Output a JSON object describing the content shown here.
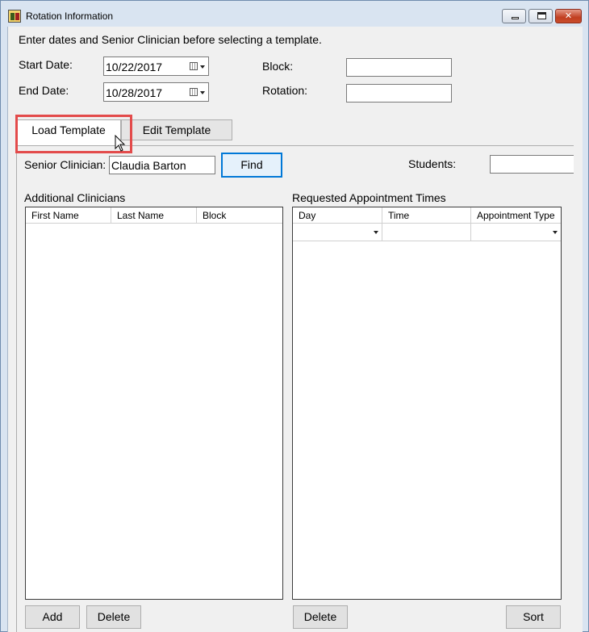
{
  "window": {
    "title": "Rotation Information",
    "controls": {
      "minimize": "minimize",
      "maximize": "maximize",
      "close": "close"
    }
  },
  "form": {
    "instructions": "Enter dates and Senior Clinician before selecting a template.",
    "start_date_label": "Start Date:",
    "start_date_value": "10/22/2017",
    "end_date_label": "End Date:",
    "end_date_value": "10/28/2017",
    "block_label": "Block:",
    "block_value": "",
    "rotation_label": "Rotation:",
    "rotation_value": ""
  },
  "tabs": [
    {
      "label": "Load Template",
      "active": true
    },
    {
      "label": "Edit Template",
      "active": false
    }
  ],
  "load_template": {
    "senior_clinician_label": "Senior Clinician:",
    "senior_clinician_value": "Claudia Barton",
    "find_button": "Find",
    "students_label": "Students:",
    "students_value": "",
    "additional_clinicians": {
      "title": "Additional Clinicians",
      "columns": [
        "First Name",
        "Last Name",
        "Block"
      ],
      "rows": [],
      "add_button": "Add",
      "delete_button": "Delete"
    },
    "requested_times": {
      "title": "Requested Appointment Times",
      "columns": [
        "Day",
        "Time",
        "Appointment Type"
      ],
      "rows": [
        {
          "day": "",
          "time": "",
          "appointment_type": ""
        }
      ],
      "delete_button": "Delete",
      "sort_button": "Sort"
    }
  },
  "icons": {
    "app": "rotation-app-icon",
    "calendar": "calendar-icon",
    "dropdown": "chevron-down-icon",
    "cursor": "mouse-pointer-icon"
  },
  "colors": {
    "highlight": "#e34b4b",
    "focus_border": "#0078d7",
    "title_bar": "#d9e4f1",
    "close_button": "#c13f21"
  }
}
